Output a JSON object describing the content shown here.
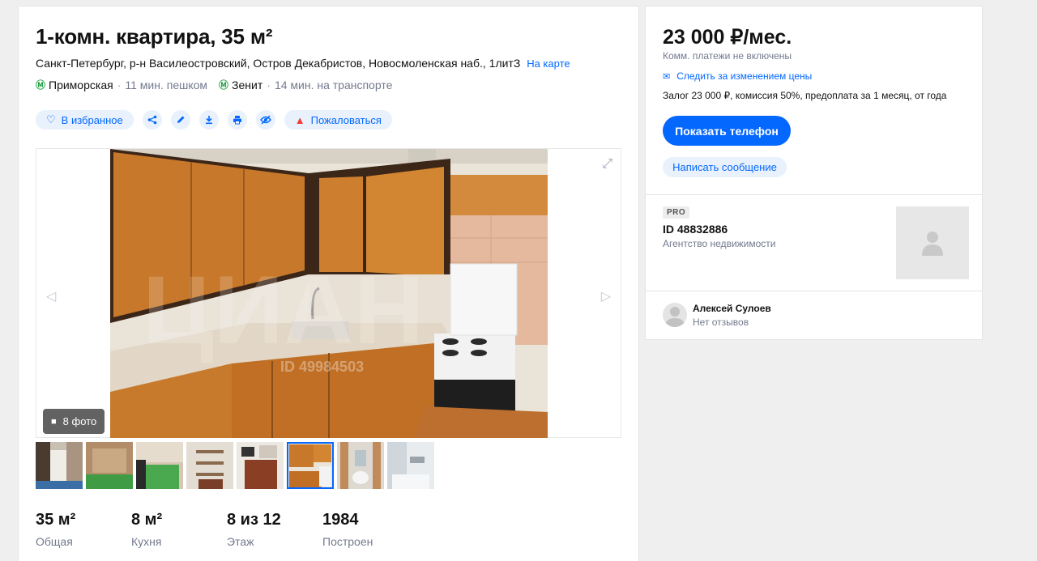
{
  "listing": {
    "title": "1-комн. квартира, 35 м²",
    "address": "Санкт-Петербург, р-н Василеостровский, Остров Декабристов, Новосмоленская наб., 1литЗ",
    "map_link": "На карте",
    "metros": [
      {
        "name": "Приморская",
        "time": "11 мин. пешком",
        "icon": "metro-icon",
        "color": "#2aa34a"
      },
      {
        "name": "Зенит",
        "time": "14 мин. на транспорте",
        "icon": "metro-icon",
        "color": "#2aa34a"
      }
    ]
  },
  "actions": {
    "favorite": "В избранное",
    "share_icon": "share-icon",
    "edit_icon": "pencil-icon",
    "download_icon": "download-icon",
    "print_icon": "print-icon",
    "hide_icon": "eye-off-icon",
    "report": "Пожаловаться"
  },
  "gallery": {
    "photo_count": "8 фото",
    "watermark": "ЦИАН",
    "watermark_id": "ID 49984503",
    "thumbnail_count": 8,
    "active_thumbnail": 6
  },
  "facts": [
    {
      "value": "35 м²",
      "label": "Общая"
    },
    {
      "value": "8 м²",
      "label": "Кухня"
    },
    {
      "value": "8 из 12",
      "label": "Этаж"
    },
    {
      "value": "1984",
      "label": "Построен"
    }
  ],
  "offer": {
    "price": "23 000 ₽/мес.",
    "price_note": "Комм. платежи не включены",
    "watch_price": "Следить за изменением цены",
    "terms": "Залог 23 000 ₽, комиссия 50%, предоплата за 1 месяц, от года",
    "show_phone": "Показать телефон",
    "write_message": "Написать сообщение"
  },
  "agent": {
    "badge": "PRO",
    "id": "ID 48832886",
    "type": "Агентство недвижимости"
  },
  "author": {
    "name": "Алексей Сулоев",
    "reviews": "Нет отзывов"
  },
  "colors": {
    "accent": "#0468ff",
    "metro": "#2aa34a",
    "report": "#f03d3d"
  }
}
